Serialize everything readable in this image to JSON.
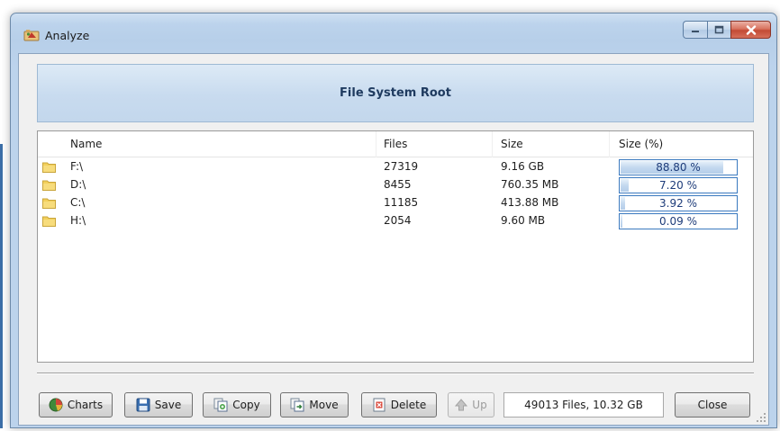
{
  "window": {
    "title": "Analyze",
    "caption_buttons": [
      "minimize-icon",
      "maximize-icon",
      "close-icon"
    ]
  },
  "header": {
    "title": "File System Root"
  },
  "table": {
    "columns": [
      "Name",
      "Files",
      "Size",
      "Size (%)"
    ],
    "rows": [
      {
        "name": "F:\\",
        "files": "27319",
        "size": "9.16 GB",
        "percent_label": "88.80 %",
        "percent": 88.8,
        "icon": "folder-icon"
      },
      {
        "name": "D:\\",
        "files": "8455",
        "size": "760.35 MB",
        "percent_label": "7.20 %",
        "percent": 7.2,
        "icon": "folder-icon"
      },
      {
        "name": "C:\\",
        "files": "11185",
        "size": "413.88 MB",
        "percent_label": "3.92 %",
        "percent": 3.92,
        "icon": "folder-icon"
      },
      {
        "name": "H:\\",
        "files": "2054",
        "size": "9.60 MB",
        "percent_label": "0.09 %",
        "percent": 0.09,
        "icon": "folder-icon"
      }
    ]
  },
  "toolbar": {
    "charts_label": "Charts",
    "save_label": "Save",
    "copy_label": "Copy",
    "move_label": "Move",
    "delete_label": "Delete",
    "up_label": "Up",
    "close_label": "Close"
  },
  "status": {
    "summary": "49013 Files, 10.32 GB"
  },
  "colors": {
    "accent": "#3a79bf",
    "header_text": "#1e3a5f",
    "folder": "#f2cf5b"
  }
}
